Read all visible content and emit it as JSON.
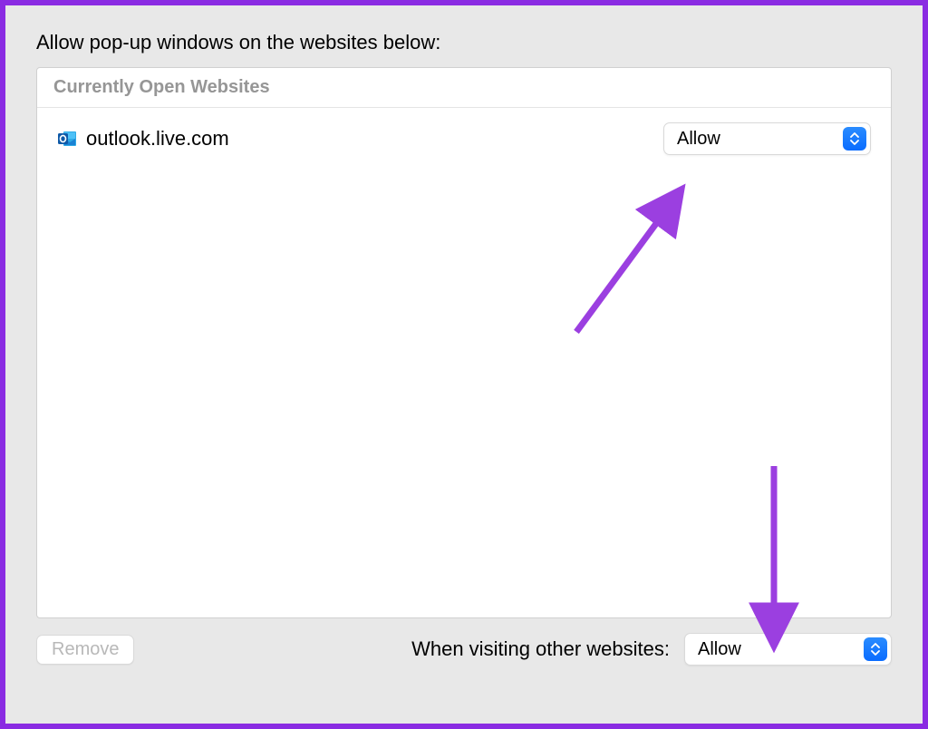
{
  "heading": "Allow pop-up windows on the websites below:",
  "section_title": "Currently Open Websites",
  "sites": [
    {
      "name": "outlook.live.com",
      "permission": "Allow"
    }
  ],
  "footer": {
    "remove_label": "Remove",
    "other_sites_label": "When visiting other websites:",
    "other_sites_permission": "Allow"
  }
}
